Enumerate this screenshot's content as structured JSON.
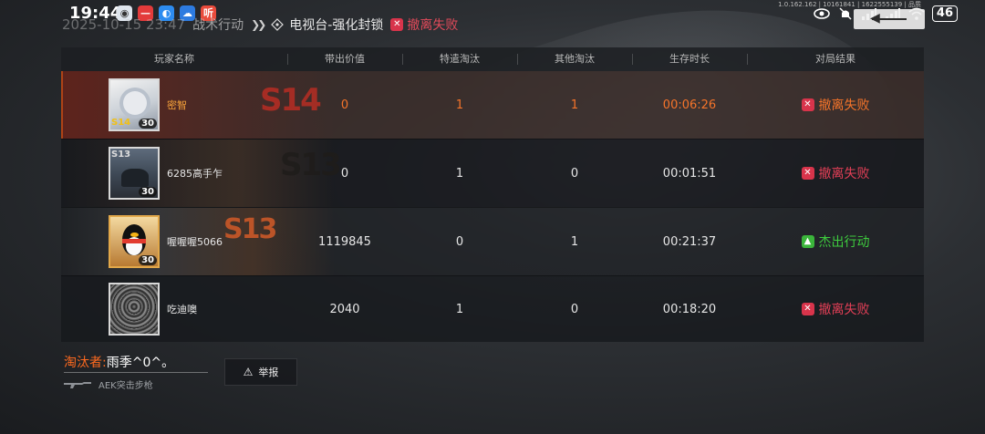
{
  "status_bar": {
    "time": "19:44",
    "battery": "46",
    "tiny_info": "1.0.162.162 | 10161841 | 1622555139 | 品质"
  },
  "breadcrumb": {
    "datetime": "2025-10-15 23:47",
    "mode": "战术行动",
    "map": "电视台-强化封锁",
    "result": "撤离失败"
  },
  "table": {
    "headers": {
      "name": "玩家名称",
      "value": "带出价值",
      "killed_by_special": "特遣淘汰",
      "other_kills": "其他淘汰",
      "survival_time": "生存时长",
      "result": "对局结果"
    },
    "rows": [
      {
        "name": "密智",
        "value": "0",
        "kills": "1",
        "other": "1",
        "time": "00:06:26",
        "result": "撤离失败",
        "result_type": "fail",
        "level": "30",
        "badge": "S14",
        "season": "S14"
      },
      {
        "name": "6285高手乍",
        "value": "0",
        "kills": "1",
        "other": "0",
        "time": "00:01:51",
        "result": "撤离失败",
        "result_type": "fail",
        "level": "30",
        "badge": "S13",
        "season": "S13"
      },
      {
        "name": "喔喔喔5066",
        "value": "1119845",
        "kills": "0",
        "other": "1",
        "time": "00:21:37",
        "result": "杰出行动",
        "result_type": "win",
        "level": "30",
        "badge": "",
        "season": "S13"
      },
      {
        "name": "吃迪噢",
        "value": "2040",
        "kills": "1",
        "other": "0",
        "time": "00:18:20",
        "result": "撤离失败",
        "result_type": "fail",
        "level": "",
        "badge": "",
        "season": ""
      }
    ]
  },
  "killer": {
    "label": "淘汰者:",
    "name": "雨季^0^。",
    "weapon": "AEK突击步枪"
  },
  "report_button": "举报",
  "colors": {
    "accent_orange": "#ff7a1a",
    "fail_red": "#e23f56",
    "win_green": "#3ecb3e"
  }
}
